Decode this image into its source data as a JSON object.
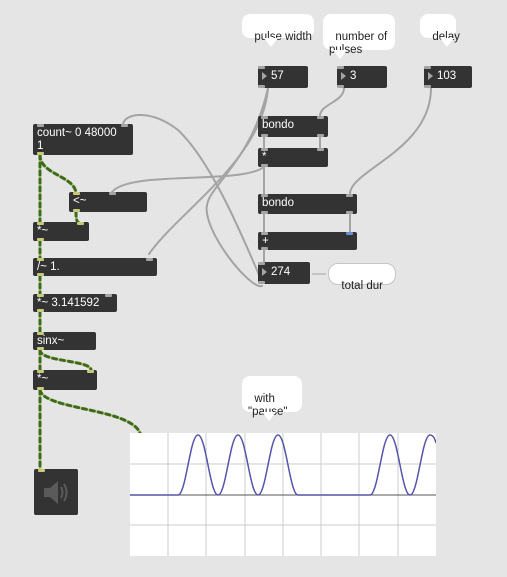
{
  "objects": {
    "count": "count~ 0 48000\n1",
    "less_than": "<~",
    "mult_a": "*~",
    "divide": "/~ 1.",
    "mult_pi": "*~ 3.141592",
    "sinx": "sinx~",
    "mult_b": "*~",
    "bondo_top": "bondo",
    "times": "*",
    "bondo_bottom": "bondo",
    "plus": "+"
  },
  "number_boxes": {
    "pulse_width": "57",
    "num_pulses": "3",
    "delay": "103",
    "total": "274"
  },
  "comments": {
    "pulse_width": "pulse width",
    "num_pulses": "number of\npulses",
    "delay": "delay",
    "total_dur": "total dur",
    "with_pause": "with\n\"pause\""
  },
  "icons": {
    "speaker": "speaker-icon"
  },
  "colors": {
    "object_bg": "#333333",
    "patch_bg": "#e5e5e5",
    "signal_cord": "#c8ca7a",
    "waveform": "#5555aa"
  }
}
